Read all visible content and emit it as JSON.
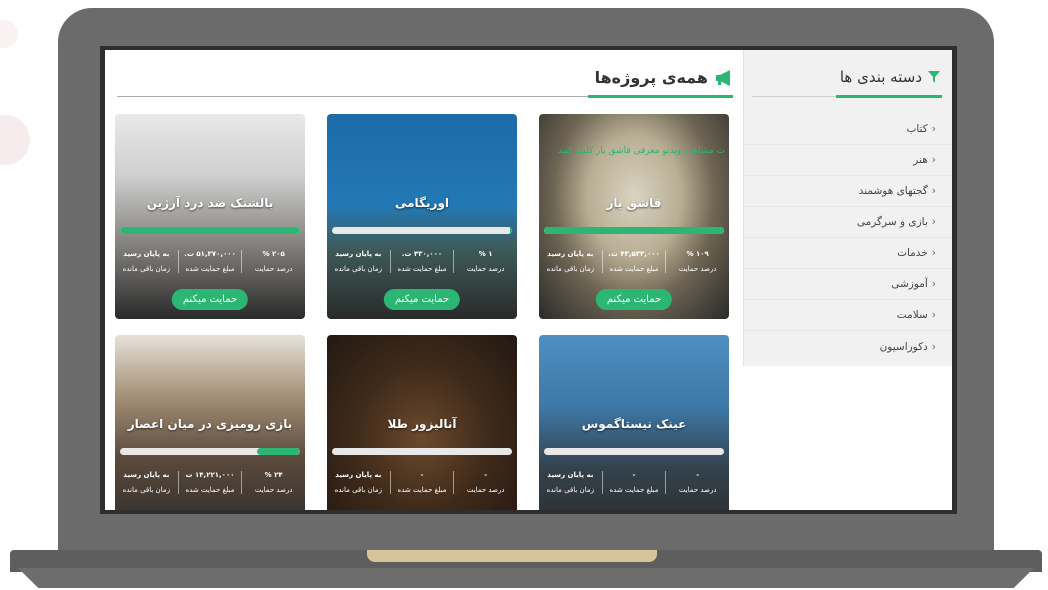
{
  "sidebar": {
    "title": "دسته بندی ها",
    "items": [
      {
        "label": "کتاب"
      },
      {
        "label": "هنر"
      },
      {
        "label": "گجتهای هوشمند"
      },
      {
        "label": "بازی و سرگرمی"
      },
      {
        "label": "خدمات"
      },
      {
        "label": "آموزشی"
      },
      {
        "label": "سلامت"
      },
      {
        "label": "دکوراسیون"
      }
    ]
  },
  "main": {
    "title": "همه‌ی پروژه‌ها"
  },
  "labels": {
    "percent": "درصد حمایت",
    "amount": "مبلغ حمایت شده",
    "time": "زمان باقی مانده",
    "button": "حمایت میکنم"
  },
  "cards": [
    {
      "title": "قاشق یار",
      "percent": "۱۰۹ %",
      "amount": "۴۳,۵۳۳,۰۰۰ ت.",
      "time": "به پایان رسید",
      "progress": 1.0,
      "marquee": "ت مشاهده ویدیو معرفی قاشق یار کلیک کنید"
    },
    {
      "title": "اوریگامی",
      "percent": "۱ %",
      "amount": "۴۳۰,۰۰۰ ت.",
      "time": "به پایان رسید",
      "progress": 0.01
    },
    {
      "title": "بالشتک ضد درد آرژین",
      "percent": "۲۰۵ %",
      "amount": "۵۱,۳۷۰,۰۰۰ ت.",
      "time": "به پایان رسید",
      "progress": 1.0
    },
    {
      "title": "عینک نیستاگموس",
      "percent": "-",
      "amount": "-",
      "time": "به پایان رسید",
      "progress": 0
    },
    {
      "title": "آنالیزور طلا",
      "percent": "-",
      "amount": "-",
      "time": "به پایان رسید",
      "progress": 0
    },
    {
      "title": "بازی رومیزی در میان اعصار",
      "percent": "۲۴ %",
      "amount": "۱۴,۲۲۱,۰۰۰ ت",
      "time": "به پایان رسید",
      "progress": 0.24
    }
  ],
  "colors": {
    "accent": "#2bb673",
    "laptop": "#6b6b6b"
  }
}
